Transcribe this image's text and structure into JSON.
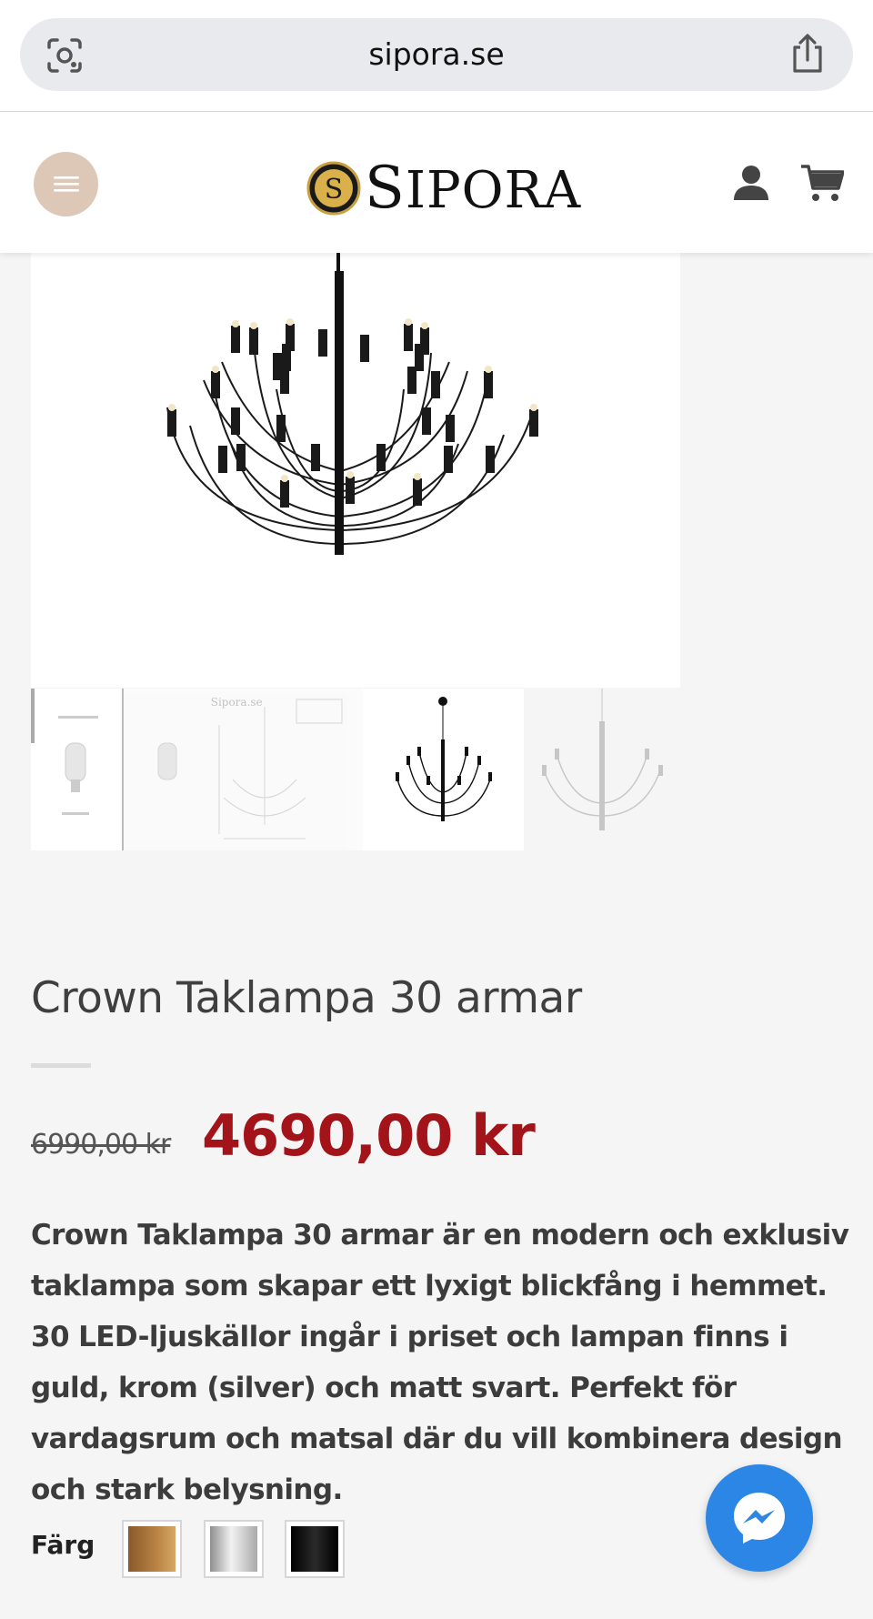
{
  "browser": {
    "url": "sipora.se"
  },
  "header": {
    "logo_letter": "S",
    "logo_text_initial": "S",
    "logo_text_rest": "IPORA"
  },
  "gallery": {
    "thumbnail_watermark": "Sipora.se"
  },
  "product": {
    "title": "Crown Taklampa 30 armar",
    "old_price": "6990,00 kr",
    "price": "4690,00 kr",
    "description": "Crown Taklampa 30 armar är en modern och exklusiv taklampa som skapar ett lyxigt blickfång i hemmet. 30 LED-ljuskällor ingår i priset och lampan finns i guld, krom (silver) och matt svart. Perfekt för vardagsrum och matsal där du vill kombinera design och stark belysning.",
    "color_label": "Färg",
    "color_options": [
      {
        "name": "gold",
        "color": "#a8733b"
      },
      {
        "name": "silver",
        "color": "#c9c9c9"
      },
      {
        "name": "black",
        "color": "#111111"
      }
    ]
  },
  "colors": {
    "price_red": "#a3141a",
    "menu_button": "#ddc8b8",
    "messenger_blue": "#2b86e6"
  }
}
